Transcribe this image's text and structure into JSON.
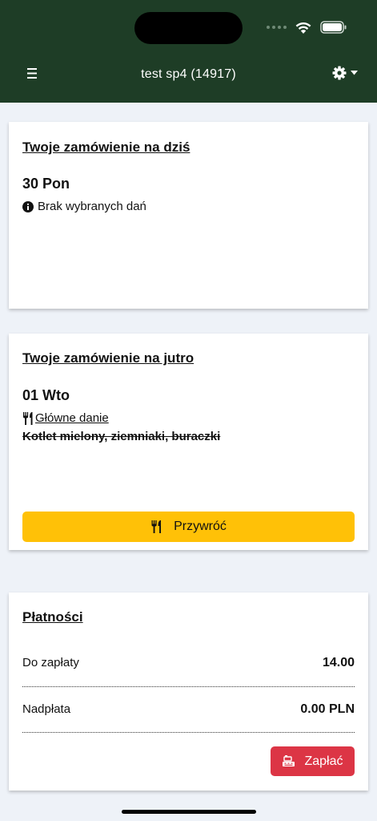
{
  "header": {
    "title": "test sp4 (14917)",
    "bg_color": "#1e3d26"
  },
  "today": {
    "title": "Twoje zamówienie na dziś",
    "day": "30 Pon",
    "info_text": "Brak wybranych dań",
    "info_icon": "info-circle-icon"
  },
  "tomorrow": {
    "title": "Twoje zamówienie na jutro",
    "day": "01 Wto",
    "category": "Główne danie",
    "category_icon": "utensils-icon",
    "dish": "Kotlet mielony, ziemniaki, buraczki",
    "restore_label": "Przywróć",
    "restore_color": "#ffc107"
  },
  "payments": {
    "title": "Płatności",
    "due_label": "Do zapłaty",
    "due_value": "14.00",
    "overpay_label": "Nadpłata",
    "overpay_value": "0.00 PLN",
    "pay_label": "Zapłać",
    "pay_color": "#dc3545"
  }
}
